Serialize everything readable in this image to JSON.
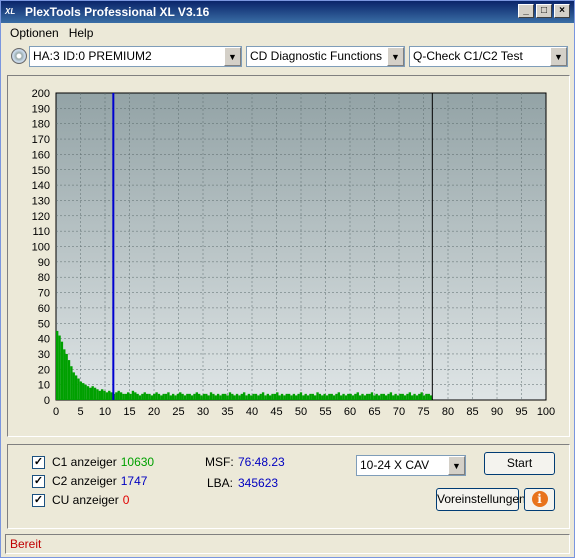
{
  "window": {
    "title": "PlexTools Professional XL V3.16",
    "logo_text": "XL"
  },
  "menu": [
    "Optionen",
    "Help"
  ],
  "toolbar": {
    "drive": "HA:3 ID:0  PREMIUM2",
    "function": "CD Diagnostic Functions",
    "test": "Q-Check C1/C2 Test"
  },
  "colors": {
    "plot_bg_top": "#93a3a6",
    "plot_bg_bottom": "#dfe5e6",
    "c1_bars": "#00a000",
    "marker_line": "#0000d0",
    "end_line": "#000000"
  },
  "chart_data": {
    "type": "bar",
    "xlim": [
      0,
      100
    ],
    "ylim": [
      0,
      200
    ],
    "x_ticks": [
      "0",
      "5",
      "10",
      "15",
      "20",
      "25",
      "30",
      "35",
      "40",
      "45",
      "50",
      "55",
      "60",
      "65",
      "70",
      "75",
      "80",
      "85",
      "90",
      "95",
      "100"
    ],
    "y_ticks": [
      "0",
      "10",
      "20",
      "30",
      "40",
      "50",
      "60",
      "70",
      "80",
      "90",
      "100",
      "110",
      "120",
      "130",
      "140",
      "150",
      "160",
      "170",
      "180",
      "190",
      "200"
    ],
    "series": [
      {
        "values": [
          45,
          42,
          38,
          33,
          30,
          26,
          22,
          18,
          16,
          14,
          12,
          11,
          10,
          9,
          8,
          9,
          8,
          7,
          6,
          7,
          6,
          5,
          6,
          5,
          4,
          5,
          6,
          5,
          4,
          4,
          5,
          4,
          6,
          5,
          4,
          3,
          4,
          5,
          4,
          4,
          3,
          4,
          5,
          4,
          3,
          4,
          4,
          5,
          3,
          4,
          3,
          4,
          5,
          4,
          3,
          4,
          4,
          3,
          4,
          5,
          4,
          3,
          4,
          4,
          3,
          5,
          4,
          3,
          4,
          3,
          4,
          4,
          3,
          5,
          4,
          3,
          4,
          3,
          4,
          5,
          3,
          4,
          3,
          4,
          4,
          3,
          4,
          5,
          3,
          4,
          3,
          4,
          4,
          5,
          3,
          4,
          3,
          4,
          4,
          3,
          4,
          3,
          4,
          5,
          3,
          4,
          3,
          4,
          4,
          3,
          5,
          4,
          3,
          4,
          3,
          4,
          4,
          3,
          4,
          5,
          3,
          4,
          3,
          4,
          4,
          3,
          4,
          5,
          3,
          4,
          3,
          4,
          4,
          5,
          3,
          4,
          3,
          4,
          4,
          3,
          4,
          5,
          3,
          4,
          3,
          4,
          4,
          3,
          4,
          5,
          3,
          4,
          3,
          4,
          5,
          3,
          4,
          4,
          3
        ]
      }
    ],
    "x_end": 76.8,
    "blue_marker_x": 11.7
  },
  "panel": {
    "c1_label": "C1 anzeiger",
    "c1_value": "10630",
    "c1_checked": "✓",
    "c2_label": "C2 anzeiger",
    "c2_value": "1747",
    "c2_checked": "✓",
    "cu_label": "CU anzeiger",
    "cu_value": "0",
    "cu_checked": "✓",
    "msf_label": "MSF:",
    "msf_value": "76:48.23",
    "lba_label": "LBA:",
    "lba_value": "345623",
    "speed": "10-24 X CAV",
    "start": "Start",
    "settings": "Voreinstellungen",
    "info_glyph": "i"
  },
  "status": "Bereit"
}
